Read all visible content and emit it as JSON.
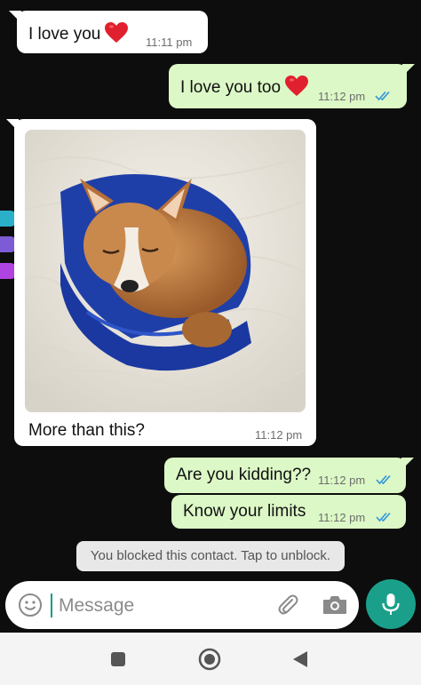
{
  "messages": [
    {
      "text": "I love you",
      "time": "11:11 pm",
      "direction": "incoming",
      "emoji": "heart"
    },
    {
      "text": "I love you too",
      "time": "11:12 pm",
      "direction": "outgoing",
      "emoji": "heart",
      "status": "read"
    },
    {
      "caption": "More than this?",
      "time": "11:12 pm",
      "direction": "incoming",
      "media": "photo of a corgi puppy sleeping in a blue pouch"
    },
    {
      "text": "Are you kidding??",
      "time": "11:12 pm",
      "direction": "outgoing",
      "status": "read"
    },
    {
      "text": "Know your limits",
      "time": "11:12 pm",
      "direction": "outgoing",
      "status": "read"
    }
  ],
  "system_notice": "You blocked this contact. Tap to unblock.",
  "composer": {
    "placeholder": "Message",
    "icons": [
      "emoji-icon",
      "paperclip-icon",
      "camera-icon",
      "microphone-icon"
    ]
  },
  "navigation": {
    "icons": [
      "recents-square-icon",
      "home-circle-icon",
      "back-triangle-icon"
    ]
  },
  "colors": {
    "chat_background": "#0d0d0d",
    "outgoing_bubble": "#dcf8c6",
    "incoming_bubble": "#ffffff",
    "accent": "#1aa08a",
    "read_ticks": "#3498db"
  }
}
